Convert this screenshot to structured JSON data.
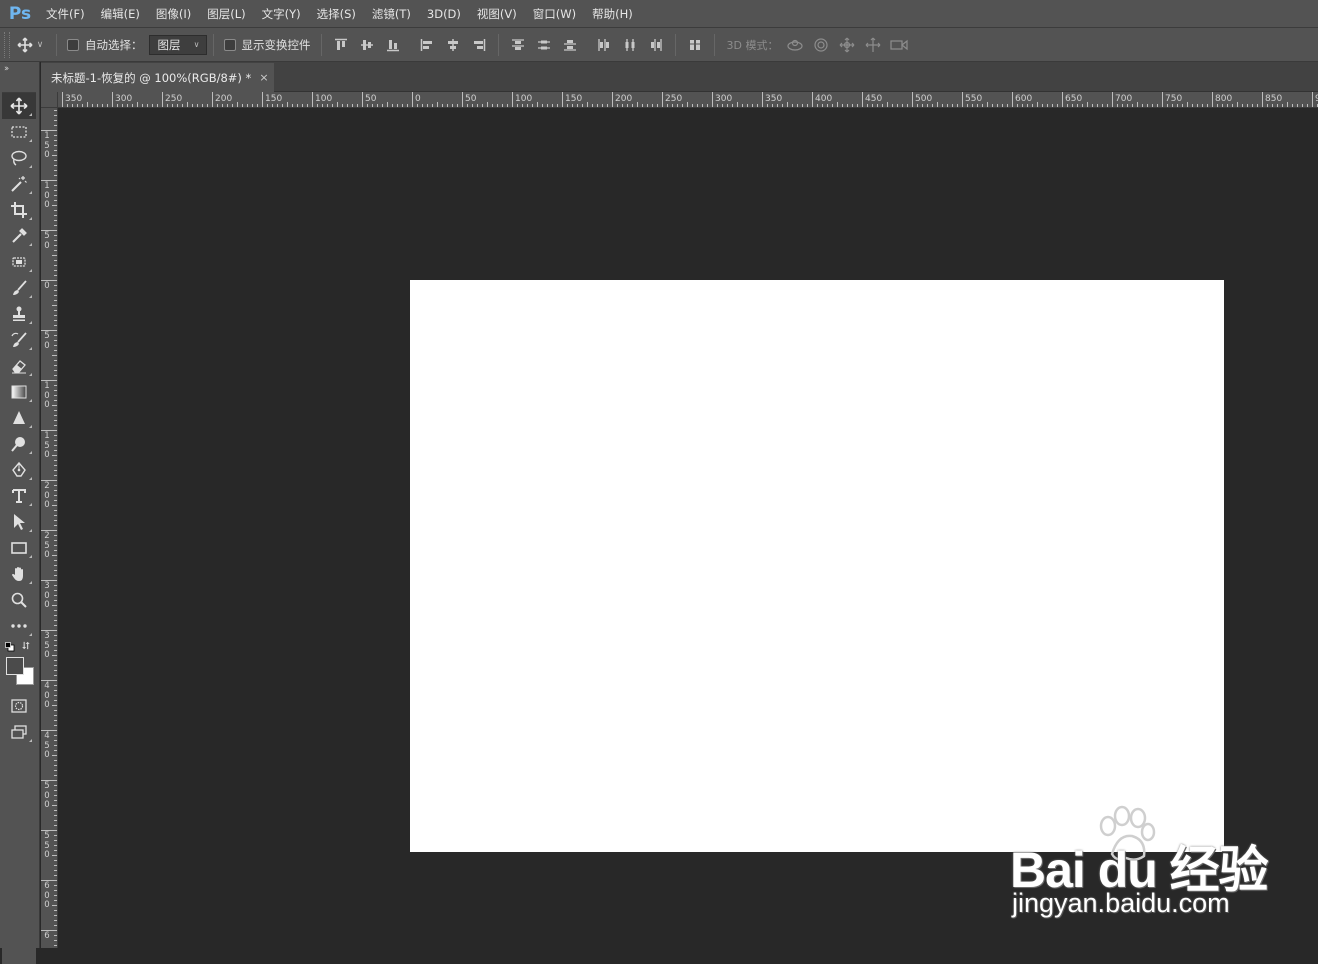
{
  "app": {
    "logo": "Ps"
  },
  "menu": [
    "文件(F)",
    "编辑(E)",
    "图像(I)",
    "图层(L)",
    "文字(Y)",
    "选择(S)",
    "滤镜(T)",
    "3D(D)",
    "视图(V)",
    "窗口(W)",
    "帮助(H)"
  ],
  "options": {
    "auto_select_label": "自动选择：",
    "auto_select_checked": false,
    "auto_select_target": "图层",
    "show_transform_label": "显示变换控件",
    "show_transform_checked": false,
    "mode_3d_label": "3D 模式："
  },
  "document_tab": {
    "title": "未标题-1-恢复的 @ 100%(RGB/8#) *",
    "close": "×"
  },
  "ruler": {
    "horizontal": [
      "350",
      "300",
      "250",
      "200",
      "150",
      "100",
      "50",
      "0",
      "50",
      "100",
      "150",
      "200",
      "250",
      "300",
      "350",
      "400",
      "450",
      "500",
      "550",
      "600",
      "650",
      "700",
      "750",
      "800",
      "850",
      "9"
    ],
    "vertical": [
      "150",
      "100",
      "50",
      "0",
      "50",
      "100",
      "150",
      "200",
      "250",
      "300",
      "350",
      "400",
      "450",
      "500",
      "550",
      "600",
      "6"
    ]
  },
  "colors": {
    "foreground": "#4b4b4b",
    "background": "#ffffff",
    "canvas": "#ffffff",
    "workspace": "#282828",
    "panel": "#535353"
  },
  "tools": [
    "move-tool",
    "marquee-tool",
    "lasso-tool",
    "magic-wand-tool",
    "crop-tool",
    "eyedropper-tool",
    "healing-brush-tool",
    "brush-tool",
    "clone-stamp-tool",
    "history-brush-tool",
    "eraser-tool",
    "gradient-tool",
    "blur-tool",
    "dodge-tool",
    "pen-tool",
    "type-tool",
    "path-selection-tool",
    "rectangle-tool",
    "hand-tool",
    "zoom-tool",
    "edit-toolbar"
  ],
  "watermark": {
    "logo": "Bai du 经验",
    "url": "jingyan.baidu.com"
  }
}
